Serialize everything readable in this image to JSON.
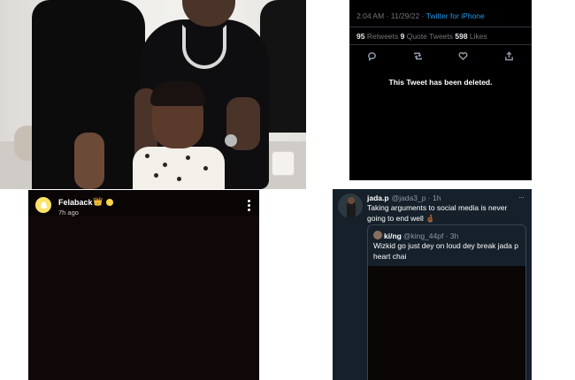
{
  "tweet": {
    "timestamp": "2:04 AM · 11/29/22 · ",
    "source": "Twitter for iPhone",
    "retweets_count": "95",
    "retweets_label": " Retweets  ",
    "quotes_count": "9",
    "quotes_label": " Quote Tweets  ",
    "likes_count": "598",
    "likes_label": " Likes",
    "actions": [
      "reply-icon",
      "retweet-icon",
      "like-icon",
      "share-icon"
    ],
    "deleted_message": "This Tweet has been deleted."
  },
  "story": {
    "username": "Felaback",
    "badge_emoji": "👑",
    "time_ago": "7h ago"
  },
  "quote_tweet": {
    "name": "jada.p",
    "handle": "@jada3_p · 1h",
    "menu": "···",
    "text": "Taking arguments to social media is never going to end well 🤞🏾",
    "quoted": {
      "name": "ki/ng",
      "handle": "@king_44pf · 3h",
      "text": "Wizkid go just dey on loud dey break jada p heart chai"
    }
  },
  "colors": {
    "twitter_blue": "#1d9bf0",
    "twitter_dim_bg": "#15202b",
    "snapchat_yellow": "#fbe36a"
  }
}
